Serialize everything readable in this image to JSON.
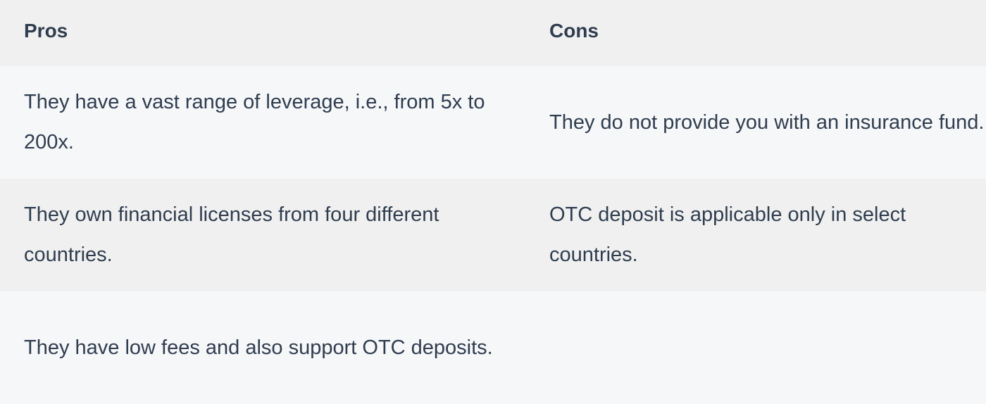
{
  "table": {
    "headers": {
      "pros": "Pros",
      "cons": "Cons"
    },
    "rows": [
      {
        "pros": "They have a vast range of leverage, i.e., from 5x to 200x.",
        "cons": "They do not provide you with an insurance fund."
      },
      {
        "pros": "They own financial licenses from four different countries.",
        "cons": "OTC deposit is applicable only in select countries."
      },
      {
        "pros": "They have low fees and also support OTC deposits.",
        "cons": ""
      }
    ]
  }
}
